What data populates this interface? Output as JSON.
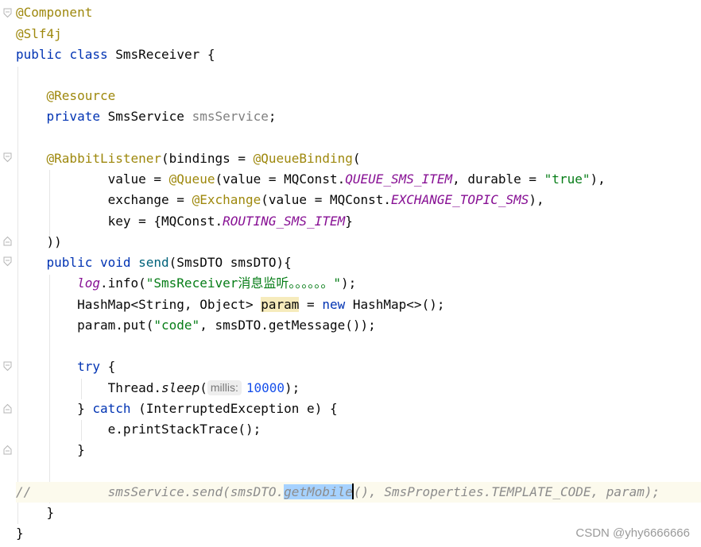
{
  "editor": {
    "lines": {
      "l1": {
        "annotation": "@Component"
      },
      "l2": {
        "annotation": "@Slf4j"
      },
      "l3": {
        "kw_public": "public",
        "kw_class": "class",
        "class_name": "SmsReceiver",
        "brace": "{"
      },
      "l5": {
        "annotation": "@Resource"
      },
      "l6": {
        "kw_private": "private",
        "type": "SmsService",
        "field": "smsService",
        "semi": ";"
      },
      "l8": {
        "annotation": "@RabbitListener",
        "text_a": "(bindings = ",
        "annotation2": "@QueueBinding",
        "text_b": "("
      },
      "l9": {
        "text_a": "value = ",
        "annotation": "@Queue",
        "text_b": "(value = MQConst.",
        "const": "QUEUE_SMS_ITEM",
        "text_c": ", durable = ",
        "str": "\"true\"",
        "text_d": "),"
      },
      "l10": {
        "text_a": "exchange = ",
        "annotation": "@Exchange",
        "text_b": "(value = MQConst.",
        "const": "EXCHANGE_TOPIC_SMS",
        "text_c": "),"
      },
      "l11": {
        "text_a": "key = {MQConst.",
        "const": "ROUTING_SMS_ITEM",
        "text_b": "}"
      },
      "l12": {
        "text": "))"
      },
      "l13": {
        "kw_public": "public",
        "kw_void": "void",
        "method": "send",
        "params": "(SmsDTO smsDTO){"
      },
      "l14": {
        "log": "log",
        "text_a": ".info(",
        "str": "\"SmsReceiver消息监听。。。。。。\"",
        "text_b": ");"
      },
      "l15": {
        "text_a": "HashMap<String, Object> ",
        "var": "param",
        "text_b": " = ",
        "kw_new": "new",
        "text_c": " HashMap<>();"
      },
      "l16": {
        "text_a": "param.put(",
        "str": "\"code\"",
        "text_b": ", smsDTO.getMessage());"
      },
      "l18": {
        "kw_try": "try",
        "text": " {"
      },
      "l19": {
        "text_a": "Thread.",
        "static": "sleep",
        "text_b": "(",
        "hint": "millis:",
        "num": "10000",
        "text_c": ");"
      },
      "l20": {
        "text_a": "} ",
        "kw_catch": "catch",
        "text_b": " (InterruptedException e) {"
      },
      "l21": {
        "text": "e.printStackTrace();"
      },
      "l22": {
        "text": "}"
      },
      "l24": {
        "prefix": "//",
        "text_a": "smsService.send(smsDTO.",
        "selected": "getMobile",
        "text_b": "(), SmsProperties.TEMPLATE_CODE, param);"
      },
      "l25": {
        "text": "}"
      },
      "l26": {
        "text": "}"
      }
    }
  },
  "watermark": "CSDN @yhy6666666"
}
